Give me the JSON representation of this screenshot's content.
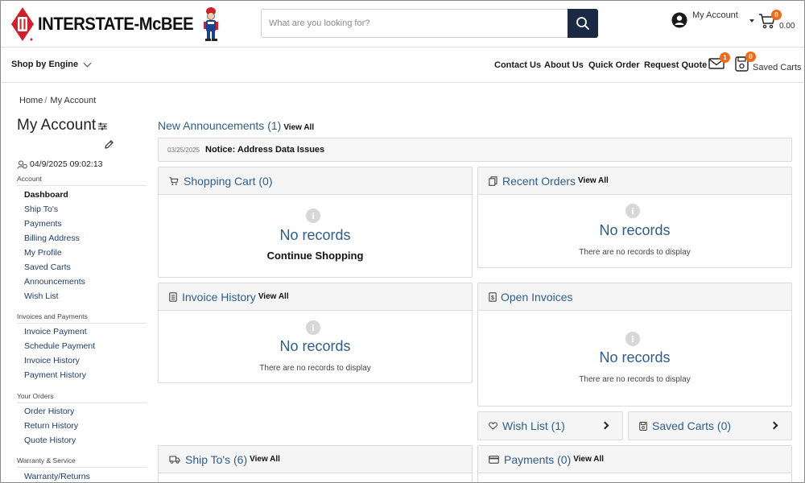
{
  "header": {
    "logo_text": "INTERSTATE-McBEE",
    "search_placeholder": "What are you looking for?",
    "account_label": "My Account",
    "cart_count": "0",
    "cart_total": "0.00"
  },
  "nav": {
    "shop_by_engine": "Shop by Engine",
    "links": [
      "Contact Us",
      "About Us",
      "Quick Order",
      "Request Quote"
    ],
    "messages_count": "1",
    "saved_carts_count": "0",
    "saved_carts_label": "Saved Carts"
  },
  "breadcrumb": {
    "home": "Home",
    "sep": "/",
    "current": "My Account"
  },
  "sidebar": {
    "title": "My Account",
    "login_time": "04/9/2025 09:02:13",
    "sections": [
      {
        "label": "Account",
        "items": [
          "Dashboard",
          "Ship To's",
          "Payments",
          "Billing Address",
          "My Profile",
          "Saved Carts",
          "Announcements",
          "Wish List"
        ]
      },
      {
        "label": "Invoices and Payments",
        "items": [
          "Invoice Payment",
          "Schedule Payment",
          "Invoice History",
          "Payment History"
        ]
      },
      {
        "label": "Your Orders",
        "items": [
          "Order History",
          "Return History",
          "Quote History"
        ]
      },
      {
        "label": "Warranty & Service",
        "items": [
          "Warranty/Returns"
        ]
      }
    ]
  },
  "announcements": {
    "title": "New Announcements (1)",
    "view_all": "View All",
    "date": "03/25/2025",
    "text": "Notice: Address Data Issues"
  },
  "cards": {
    "shopping_cart": {
      "title": "Shopping Cart (0)",
      "empty": "No records",
      "action": "Continue Shopping"
    },
    "recent_orders": {
      "title": "Recent Orders",
      "view_all": "View All",
      "empty": "No records",
      "sub": "There are no records to display"
    },
    "invoice_history": {
      "title": "Invoice History",
      "view_all": "View All",
      "empty": "No records",
      "sub": "There are no records to display"
    },
    "open_invoices": {
      "title": "Open Invoices",
      "empty": "No records",
      "sub": "There are no records to display"
    },
    "wish_list": {
      "title": "Wish List (1)"
    },
    "saved_carts": {
      "title": "Saved Carts (0)"
    },
    "ship_tos": {
      "title": "Ship To's (6)",
      "view_all": "View All"
    },
    "payments": {
      "title": "Payments (0)",
      "view_all": "View All"
    }
  },
  "colors": {
    "brand_red": "#d0202a",
    "accent_blue": "#2e5d8a",
    "search_btn": "#1b2a44",
    "badge": "#ef6a1b"
  },
  "icons": [
    "search-icon",
    "user-icon",
    "cart-icon",
    "envelope-icon",
    "saved-cart-icon",
    "info-icon",
    "pencil-icon",
    "history-icon",
    "heart-icon",
    "truck-icon",
    "card-icon",
    "invoice-icon",
    "orders-icon"
  ]
}
